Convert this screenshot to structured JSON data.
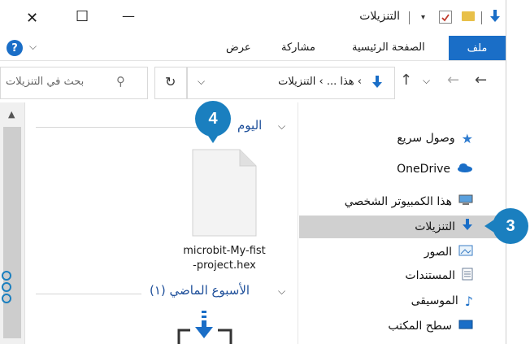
{
  "window": {
    "title": "التنزيلات",
    "close_symbol": "✕",
    "maximize_symbol": "☐",
    "minimize_symbol": "—"
  },
  "ribbon": {
    "tabs": [
      "ملف",
      "الصفحة الرئيسية",
      "مشاركة",
      "عرض"
    ],
    "help_symbol": "?"
  },
  "address": {
    "path": "› هذا ... › التنزيلات",
    "search_placeholder": "بحث في التنزيلات"
  },
  "sidebar": {
    "items": [
      {
        "label": "وصول سريع",
        "icon": "star-icon"
      },
      {
        "label": "OneDrive",
        "icon": "cloud-icon"
      },
      {
        "label": "هذا الكمبيوتر الشخصي",
        "icon": "computer-icon"
      },
      {
        "label": "التنزيلات",
        "icon": "download-icon"
      },
      {
        "label": "الصور",
        "icon": "pictures-icon"
      },
      {
        "label": "المستندات",
        "icon": "documents-icon"
      },
      {
        "label": "الموسيقى",
        "icon": "music-icon"
      },
      {
        "label": "سطح المكتب",
        "icon": "desktop-icon"
      }
    ]
  },
  "content": {
    "group_today": "اليوم",
    "group_last_week": "الأسبوع الماضي (١)",
    "file_name_line1": "microbit-My-fist",
    "file_name_line2": "-project.hex"
  },
  "badges": {
    "b3": "3",
    "b4": "4"
  },
  "colors": {
    "accent": "#1a6ec7",
    "badge": "#1a7fbf",
    "selection": "#d0d0d0",
    "header_text": "#1e4f9a"
  }
}
